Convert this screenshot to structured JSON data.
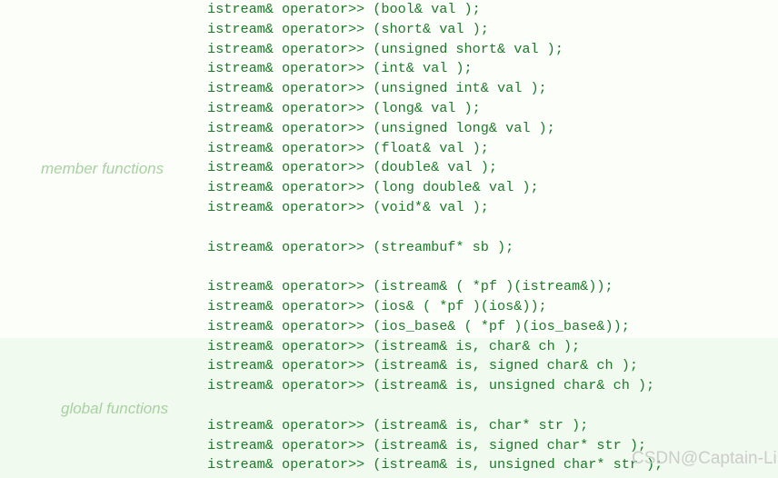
{
  "page": {
    "background_color": "#fbfef9",
    "band_color": "#f1faef",
    "code_color": "#1d7a2a",
    "label_color": "#a9d0a2",
    "watermark_color": "#c9c9c9"
  },
  "labels": {
    "member_functions": "member functions",
    "global_functions": "global functions"
  },
  "watermark": {
    "text": "CSDN@Captain-Lin"
  },
  "code": {
    "lines": [
      "istream& operator>> (bool& val );",
      "istream& operator>> (short& val );",
      "istream& operator>> (unsigned short& val );",
      "istream& operator>> (int& val );",
      "istream& operator>> (unsigned int& val );",
      "istream& operator>> (long& val );",
      "istream& operator>> (unsigned long& val );",
      "istream& operator>> (float& val );",
      "istream& operator>> (double& val );",
      "istream& operator>> (long double& val );",
      "istream& operator>> (void*& val );",
      "",
      "istream& operator>> (streambuf* sb );",
      "",
      "istream& operator>> (istream& ( *pf )(istream&));",
      "istream& operator>> (ios& ( *pf )(ios&));",
      "istream& operator>> (ios_base& ( *pf )(ios_base&));",
      "istream& operator>> (istream& is, char& ch );",
      "istream& operator>> (istream& is, signed char& ch );",
      "istream& operator>> (istream& is, unsigned char& ch );",
      "",
      "istream& operator>> (istream& is, char* str );",
      "istream& operator>> (istream& is, signed char* str );",
      "istream& operator>> (istream& is, unsigned char* str );"
    ]
  }
}
